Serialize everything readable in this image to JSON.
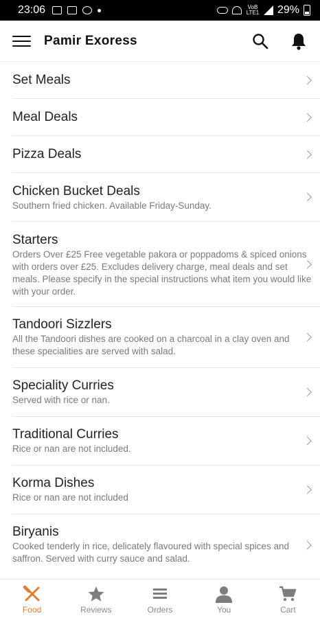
{
  "status_bar": {
    "time": "23:06",
    "battery": "29%",
    "network_label": "VoB LTE1"
  },
  "header": {
    "title": "Pamir Exoress"
  },
  "menu": {
    "items": [
      {
        "title": "Set Meals",
        "desc": ""
      },
      {
        "title": "Meal Deals",
        "desc": ""
      },
      {
        "title": "Pizza Deals",
        "desc": ""
      },
      {
        "title": "Chicken Bucket Deals",
        "desc": "Southern fried chicken. Available Friday-Sunday."
      },
      {
        "title": "Starters",
        "desc": "Orders Over £25 Free vegetable pakora or poppadoms & spiced onions with orders over £25. Excludes delivery charge, meal deals and set meals. Please specify in the special instructions what item you would like with your order."
      },
      {
        "title": "Tandoori Sizzlers",
        "desc": "All the Tandoori dishes are cooked on a charcoal in a clay oven and these specialities are served with salad."
      },
      {
        "title": "Speciality Curries",
        "desc": "Served with rice or nan."
      },
      {
        "title": "Traditional Curries",
        "desc": "Rice or nan are not included."
      },
      {
        "title": "Korma Dishes",
        "desc": "Rice or nan are not included"
      },
      {
        "title": "Biryanis",
        "desc": "Cooked tenderly in rice, delicately flavoured with special spices and saffron. Served with curry sauce and salad."
      }
    ]
  },
  "bottom_nav": {
    "tabs": [
      {
        "label": "Food",
        "icon": "fork-knife-icon",
        "active": true
      },
      {
        "label": "Reviews",
        "icon": "star-icon",
        "active": false
      },
      {
        "label": "Orders",
        "icon": "list-icon",
        "active": false
      },
      {
        "label": "You",
        "icon": "person-icon",
        "active": false
      },
      {
        "label": "Cart",
        "icon": "cart-icon",
        "active": false
      }
    ]
  },
  "colors": {
    "accent": "#e8792b",
    "inactive": "#8a8a8a",
    "text": "#222222",
    "subtext": "#7a7a7a"
  }
}
